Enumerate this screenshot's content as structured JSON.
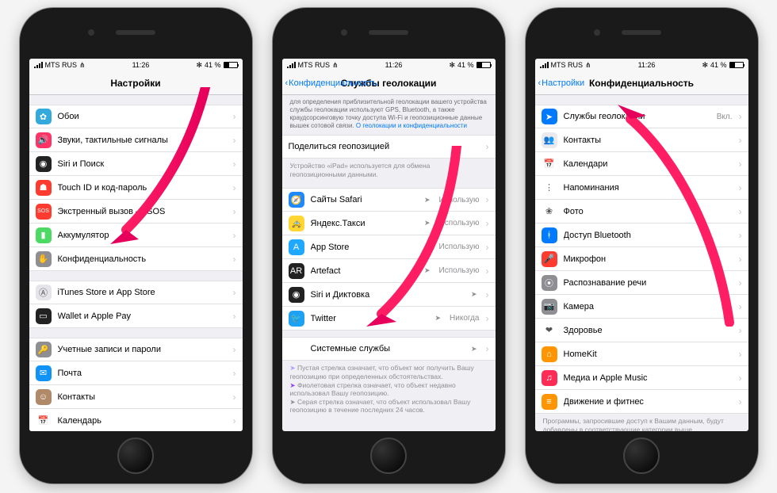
{
  "status": {
    "carrier": "MTS RUS",
    "time": "11:26",
    "bt": "✻",
    "pct": "41 %"
  },
  "phone1": {
    "title": "Настройки",
    "g1": [
      {
        "label": "Обои",
        "bg": "#34aadc",
        "glyph": "✿"
      },
      {
        "label": "Звуки, тактильные сигналы",
        "bg": "#ff3366",
        "glyph": "🔊"
      },
      {
        "label": "Siri и Поиск",
        "bg": "#222",
        "glyph": "◉"
      },
      {
        "label": "Touch ID и код-пароль",
        "bg": "#ff3b30",
        "glyph": "☗"
      },
      {
        "label": "Экстренный вызов — SOS",
        "bg": "#ff3b30",
        "glyph": "SOS"
      },
      {
        "label": "Аккумулятор",
        "bg": "#4cd964",
        "glyph": "▮"
      },
      {
        "label": "Конфиденциальность",
        "bg": "#8e8e93",
        "glyph": "✋"
      }
    ],
    "g2": [
      {
        "label": "iTunes Store и App Store",
        "bg": "#e4e4ea",
        "glyph": "Ⓐ"
      },
      {
        "label": "Wallet и Apple Pay",
        "bg": "#222",
        "glyph": "▭"
      }
    ],
    "g3": [
      {
        "label": "Учетные записи и пароли",
        "bg": "#8e8e93",
        "glyph": "🔑"
      },
      {
        "label": "Почта",
        "bg": "#1192f6",
        "glyph": "✉"
      },
      {
        "label": "Контакты",
        "bg": "#b08968",
        "glyph": "☺"
      },
      {
        "label": "Календарь",
        "bg": "#fff",
        "glyph": "📅"
      }
    ]
  },
  "phone2": {
    "back": "Конфиденциальность",
    "title": "Службы геолокации",
    "desc": "для определения приблизительной геолокации вашего устройства службы геолокации используют GPS, Bluetooth, а также краудсорсинговую точку доступа Wi-Fi и геопозиционные данные вышек сотовой связи.",
    "desclink": "О геолокации и конфиденциальности",
    "share": {
      "label": "Поделиться геопозицией"
    },
    "sharefoot": "Устройство «iPad» используется для обмена геопозиционными данными.",
    "apps": [
      {
        "label": "Сайты Safari",
        "detail": "Использую",
        "bg": "#1e88ff",
        "glyph": "🧭"
      },
      {
        "label": "Яндекс.Такси",
        "detail": "Использую",
        "bg": "#ffd633",
        "glyph": "🚕"
      },
      {
        "label": "App Store",
        "detail": "Использую",
        "bg": "#1fa8ff",
        "glyph": "A"
      },
      {
        "label": "Artefact",
        "detail": "Использую",
        "bg": "#222",
        "glyph": "AR"
      },
      {
        "label": "Siri и Диктовка",
        "detail": "",
        "bg": "#222",
        "glyph": "◉"
      },
      {
        "label": "Twitter",
        "detail": "Никогда",
        "bg": "#1da1f2",
        "glyph": "🐦"
      }
    ],
    "sys": {
      "label": "Системные службы"
    },
    "legend1": "Пустая стрелка означает, что объект мог получить Вашу геопозицию при определенных обстоятельствах.",
    "legend2": "Фиолетовая стрелка означает, что объект недавно использовал Вашу геопозицию.",
    "legend3": "Серая стрелка означает, что объект использовал Вашу геопозицию в течение последних 24 часов."
  },
  "phone3": {
    "back": "Настройки",
    "title": "Конфиденциальность",
    "g1": [
      {
        "label": "Службы геолокации",
        "detail": "Вкл.",
        "bg": "#007aff",
        "glyph": "➤"
      },
      {
        "label": "Контакты",
        "bg": "#e9e9ee",
        "glyph": "👥"
      },
      {
        "label": "Календари",
        "bg": "#fff",
        "glyph": "📅"
      },
      {
        "label": "Напоминания",
        "bg": "#fff",
        "glyph": "⋮"
      },
      {
        "label": "Фото",
        "bg": "#fff",
        "glyph": "❀"
      },
      {
        "label": "Доступ Bluetooth",
        "bg": "#007aff",
        "glyph": "ᚼ"
      },
      {
        "label": "Микрофон",
        "bg": "#ff3b30",
        "glyph": "🎤"
      },
      {
        "label": "Распознавание речи",
        "bg": "#8e8e93",
        "glyph": "⦿"
      },
      {
        "label": "Камера",
        "bg": "#8e8e93",
        "glyph": "📷"
      },
      {
        "label": "Здоровье",
        "bg": "#fff",
        "glyph": "❤"
      },
      {
        "label": "HomeKit",
        "bg": "#ff9500",
        "glyph": "⌂"
      },
      {
        "label": "Медиа и Apple Music",
        "bg": "#ff2d55",
        "glyph": "♫"
      },
      {
        "label": "Движение и фитнес",
        "bg": "#ff9500",
        "glyph": "≡"
      }
    ],
    "foot": "Программы, запросившие доступ к Вашим данным, будут добавлены в соответствующие категории выше."
  }
}
